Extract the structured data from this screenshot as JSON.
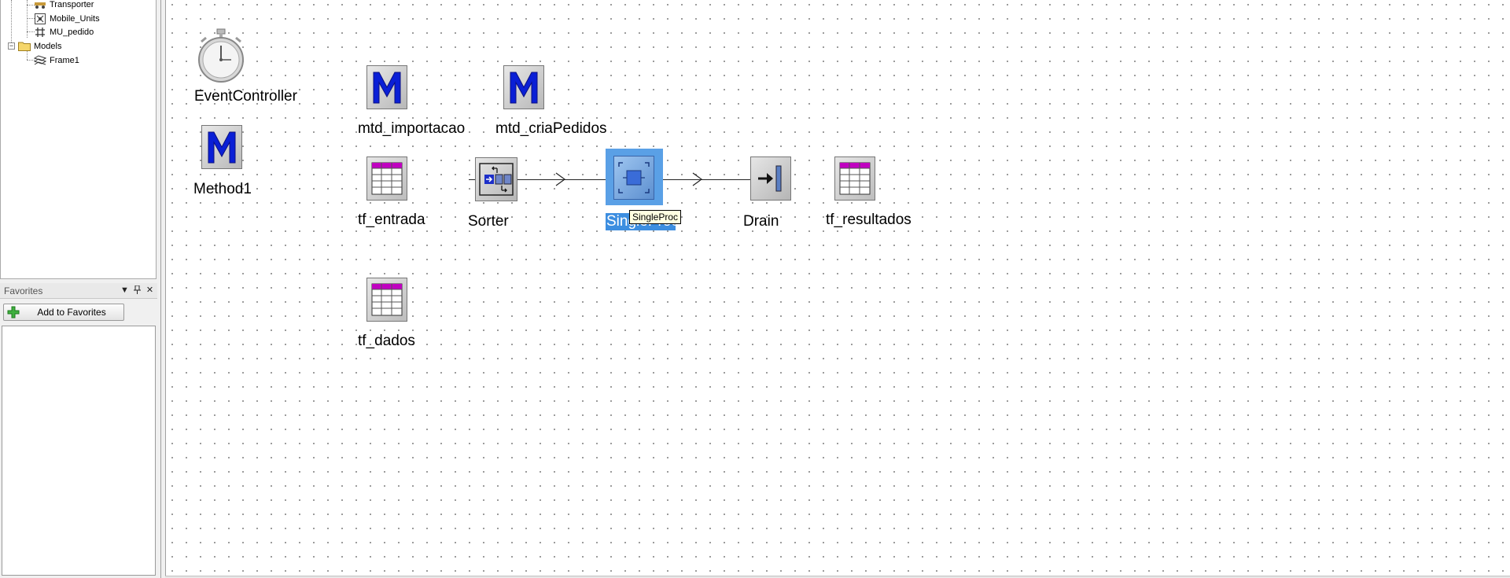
{
  "tree": {
    "items": [
      {
        "label": "Transporter",
        "icon": "transporter-icon"
      },
      {
        "label": "Mobile_Units",
        "icon": "mobile-units-icon"
      },
      {
        "label": "MU_pedido",
        "icon": "mu-grid-icon"
      },
      {
        "label": "Models",
        "icon": "folder-icon"
      },
      {
        "label": "Frame1",
        "icon": "frame-icon"
      }
    ]
  },
  "favorites": {
    "title": "Favorites",
    "add_label": "Add to Favorites"
  },
  "canvas": {
    "objects": {
      "event_controller": "EventController",
      "method1": "Method1",
      "mtd_importacao": "mtd_importacao",
      "mtd_criaPedidos": "mtd_criaPedidos",
      "tf_entrada": "tf_entrada",
      "sorter": "Sorter",
      "single_proc": "SingleProc",
      "drain": "Drain",
      "tf_resultados": "tf_resultados",
      "tf_dados": "tf_dados"
    },
    "tooltip": "SingleProc"
  },
  "colors": {
    "selection": "#5aa0e6",
    "method_m": "#0a1fd6",
    "table_header": "#c000c0"
  }
}
